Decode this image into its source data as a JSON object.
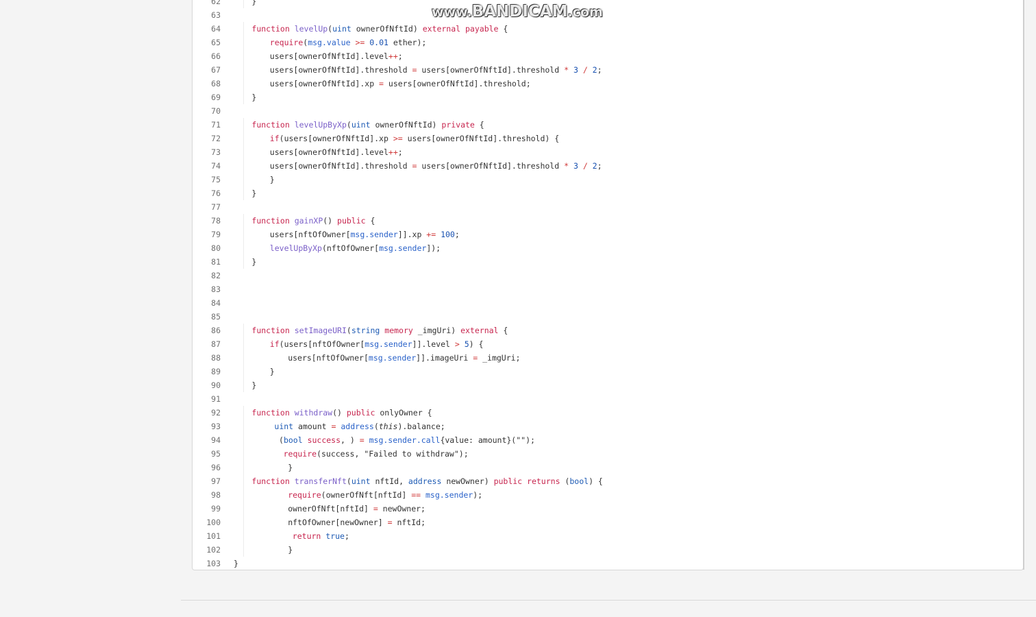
{
  "watermark": {
    "prefix": "www.",
    "brand": "BANDICAM",
    "suffix": ".com"
  },
  "colors": {
    "page_background": "#f4f4f4",
    "panel_background": "#ffffff",
    "keyword": "#c7254e",
    "type": "#1e5bb4",
    "function_name": "#7a5fc8",
    "builtin": "#2a62c9",
    "number": "#1750b0",
    "operator": "#d03a3a",
    "line_number": "#707070",
    "text": "#333333"
  },
  "code_lines": [
    {
      "num": "62",
      "indent": 4,
      "tokens": [
        [
          "pl",
          "}"
        ]
      ]
    },
    {
      "num": "63",
      "indent": 0,
      "tokens": []
    },
    {
      "num": "64",
      "indent": 4,
      "tokens": [
        [
          "kw",
          "function "
        ],
        [
          "fn",
          "levelUp"
        ],
        [
          "pl",
          "("
        ],
        [
          "ty",
          "uint"
        ],
        [
          "st",
          " ownerOfNftId"
        ],
        [
          "pl",
          ") "
        ],
        [
          "kw",
          "external payable"
        ],
        [
          "pl",
          " {"
        ]
      ]
    },
    {
      "num": "65",
      "indent": 8,
      "tokens": [
        [
          "kw",
          "require"
        ],
        [
          "pl",
          "("
        ],
        [
          "sy",
          "msg.value"
        ],
        [
          "op",
          " >= "
        ],
        [
          "nu",
          "0.01"
        ],
        [
          "pl",
          " ether);"
        ]
      ]
    },
    {
      "num": "66",
      "indent": 8,
      "tokens": [
        [
          "pl",
          "users[ownerOfNftId].level"
        ],
        [
          "op",
          "++"
        ],
        [
          "pl",
          ";"
        ]
      ]
    },
    {
      "num": "67",
      "indent": 8,
      "tokens": [
        [
          "pl",
          "users[ownerOfNftId].threshold"
        ],
        [
          "op",
          " = "
        ],
        [
          "pl",
          "users[ownerOfNftId].threshold"
        ],
        [
          "op",
          " * "
        ],
        [
          "nu",
          "3"
        ],
        [
          "op",
          " / "
        ],
        [
          "nu",
          "2"
        ],
        [
          "pl",
          ";"
        ]
      ]
    },
    {
      "num": "68",
      "indent": 8,
      "tokens": [
        [
          "pl",
          "users[ownerOfNftId].xp"
        ],
        [
          "op",
          " = "
        ],
        [
          "pl",
          "users[ownerOfNftId].threshold;"
        ]
      ]
    },
    {
      "num": "69",
      "indent": 4,
      "tokens": [
        [
          "pl",
          "}"
        ]
      ]
    },
    {
      "num": "70",
      "indent": 0,
      "tokens": []
    },
    {
      "num": "71",
      "indent": 4,
      "tokens": [
        [
          "kw",
          "function "
        ],
        [
          "fn",
          "levelUpByXp"
        ],
        [
          "pl",
          "("
        ],
        [
          "ty",
          "uint"
        ],
        [
          "st",
          " ownerOfNftId"
        ],
        [
          "pl",
          ") "
        ],
        [
          "kw",
          "private"
        ],
        [
          "pl",
          " {"
        ]
      ]
    },
    {
      "num": "72",
      "indent": 8,
      "tokens": [
        [
          "kw",
          "if"
        ],
        [
          "pl",
          "(users[ownerOfNftId].xp"
        ],
        [
          "op",
          " >= "
        ],
        [
          "pl",
          "users[ownerOfNftId].threshold) {"
        ]
      ]
    },
    {
      "num": "73",
      "indent": 8,
      "tokens": [
        [
          "pl",
          "users[ownerOfNftId].level"
        ],
        [
          "op",
          "++"
        ],
        [
          "pl",
          ";"
        ]
      ]
    },
    {
      "num": "74",
      "indent": 8,
      "tokens": [
        [
          "pl",
          "users[ownerOfNftId].threshold"
        ],
        [
          "op",
          " = "
        ],
        [
          "pl",
          "users[ownerOfNftId].threshold"
        ],
        [
          "op",
          " * "
        ],
        [
          "nu",
          "3"
        ],
        [
          "op",
          " / "
        ],
        [
          "nu",
          "2"
        ],
        [
          "pl",
          ";"
        ]
      ]
    },
    {
      "num": "75",
      "indent": 8,
      "tokens": [
        [
          "pl",
          "}"
        ]
      ]
    },
    {
      "num": "76",
      "indent": 4,
      "tokens": [
        [
          "pl",
          "}"
        ]
      ]
    },
    {
      "num": "77",
      "indent": 0,
      "tokens": []
    },
    {
      "num": "78",
      "indent": 4,
      "tokens": [
        [
          "kw",
          "function "
        ],
        [
          "fn",
          "gainXP"
        ],
        [
          "pl",
          "() "
        ],
        [
          "kw",
          "public"
        ],
        [
          "pl",
          " {"
        ]
      ]
    },
    {
      "num": "79",
      "indent": 8,
      "tokens": [
        [
          "pl",
          "users[nftOfOwner["
        ],
        [
          "sy",
          "msg.sender"
        ],
        [
          "pl",
          "]].xp"
        ],
        [
          "op",
          " += "
        ],
        [
          "nu",
          "100"
        ],
        [
          "pl",
          ";"
        ]
      ]
    },
    {
      "num": "80",
      "indent": 8,
      "tokens": [
        [
          "fn",
          "levelUpByXp"
        ],
        [
          "pl",
          "(nftOfOwner["
        ],
        [
          "sy",
          "msg.sender"
        ],
        [
          "pl",
          "]);"
        ]
      ]
    },
    {
      "num": "81",
      "indent": 4,
      "tokens": [
        [
          "pl",
          "}"
        ]
      ]
    },
    {
      "num": "82",
      "indent": 0,
      "tokens": []
    },
    {
      "num": "83",
      "indent": 0,
      "tokens": []
    },
    {
      "num": "84",
      "indent": 0,
      "tokens": []
    },
    {
      "num": "85",
      "indent": 0,
      "tokens": []
    },
    {
      "num": "86",
      "indent": 4,
      "tokens": [
        [
          "kw",
          "function "
        ],
        [
          "fn",
          "setImageURI"
        ],
        [
          "pl",
          "("
        ],
        [
          "ty",
          "string"
        ],
        [
          "kw",
          " memory"
        ],
        [
          "st",
          " _imgUri"
        ],
        [
          "pl",
          ") "
        ],
        [
          "kw",
          "external"
        ],
        [
          "pl",
          " {"
        ]
      ]
    },
    {
      "num": "87",
      "indent": 8,
      "tokens": [
        [
          "kw",
          "if"
        ],
        [
          "pl",
          "(users[nftOfOwner["
        ],
        [
          "sy",
          "msg.sender"
        ],
        [
          "pl",
          "]].level"
        ],
        [
          "op",
          " > "
        ],
        [
          "nu",
          "5"
        ],
        [
          "pl",
          ") {"
        ]
      ]
    },
    {
      "num": "88",
      "indent": 12,
      "tokens": [
        [
          "pl",
          "users[nftOfOwner["
        ],
        [
          "sy",
          "msg.sender"
        ],
        [
          "pl",
          "]].imageUri"
        ],
        [
          "op",
          " = "
        ],
        [
          "pl",
          "_imgUri;"
        ]
      ]
    },
    {
      "num": "89",
      "indent": 8,
      "tokens": [
        [
          "pl",
          "}"
        ]
      ]
    },
    {
      "num": "90",
      "indent": 4,
      "tokens": [
        [
          "pl",
          "}"
        ]
      ]
    },
    {
      "num": "91",
      "indent": 0,
      "tokens": []
    },
    {
      "num": "92",
      "indent": 4,
      "tokens": [
        [
          "kw",
          "function "
        ],
        [
          "fn",
          "withdraw"
        ],
        [
          "pl",
          "() "
        ],
        [
          "kw",
          "public"
        ],
        [
          "pl",
          " onlyOwner {"
        ]
      ]
    },
    {
      "num": "93",
      "indent": 9,
      "tokens": [
        [
          "ty",
          "uint"
        ],
        [
          "pl",
          " amount"
        ],
        [
          "op",
          " = "
        ],
        [
          "sy",
          "address"
        ],
        [
          "pl",
          "("
        ],
        [
          "th",
          "this"
        ],
        [
          "pl",
          ").balance;"
        ]
      ]
    },
    {
      "num": "94",
      "indent": 10,
      "tokens": [
        [
          "pl",
          "("
        ],
        [
          "ty",
          "bool"
        ],
        [
          "kw",
          " success"
        ],
        [
          "pl",
          ", )"
        ],
        [
          "op",
          " = "
        ],
        [
          "sy",
          "msg.sender.call"
        ],
        [
          "pl",
          "{value: amount}(\"\");"
        ]
      ]
    },
    {
      "num": "95",
      "indent": 11,
      "tokens": [
        [
          "kw",
          "require"
        ],
        [
          "pl",
          "(success, \"Failed to withdraw\");"
        ]
      ]
    },
    {
      "num": "96",
      "indent": 12,
      "tokens": [
        [
          "pl",
          "}"
        ]
      ]
    },
    {
      "num": "97",
      "indent": 4,
      "tokens": [
        [
          "kw",
          "function "
        ],
        [
          "fn",
          "transferNft"
        ],
        [
          "pl",
          "("
        ],
        [
          "ty",
          "uint"
        ],
        [
          "st",
          " nftId"
        ],
        [
          "pl",
          ", "
        ],
        [
          "ty",
          "address"
        ],
        [
          "st",
          " newOwner"
        ],
        [
          "pl",
          ") "
        ],
        [
          "kw",
          "public returns"
        ],
        [
          "pl",
          " ("
        ],
        [
          "ty",
          "bool"
        ],
        [
          "pl",
          ") {"
        ]
      ]
    },
    {
      "num": "98",
      "indent": 12,
      "tokens": [
        [
          "kw",
          "require"
        ],
        [
          "pl",
          "(ownerOfNft[nftId]"
        ],
        [
          "op",
          " == "
        ],
        [
          "sy",
          "msg.sender"
        ],
        [
          "pl",
          ");"
        ]
      ]
    },
    {
      "num": "99",
      "indent": 12,
      "tokens": [
        [
          "pl",
          "ownerOfNft[nftId]"
        ],
        [
          "op",
          " = "
        ],
        [
          "pl",
          "newOwner;"
        ]
      ]
    },
    {
      "num": "100",
      "indent": 12,
      "tokens": [
        [
          "pl",
          "nftOfOwner[newOwner]"
        ],
        [
          "op",
          " = "
        ],
        [
          "pl",
          "nftId;"
        ]
      ]
    },
    {
      "num": "101",
      "indent": 13,
      "tokens": [
        [
          "kw",
          "return"
        ],
        [
          "ty",
          " true"
        ],
        [
          "pl",
          ";"
        ]
      ]
    },
    {
      "num": "102",
      "indent": 12,
      "tokens": [
        [
          "pl",
          "}"
        ]
      ]
    },
    {
      "num": "103",
      "indent": 0,
      "tokens": [
        [
          "pl",
          "}"
        ]
      ]
    }
  ]
}
